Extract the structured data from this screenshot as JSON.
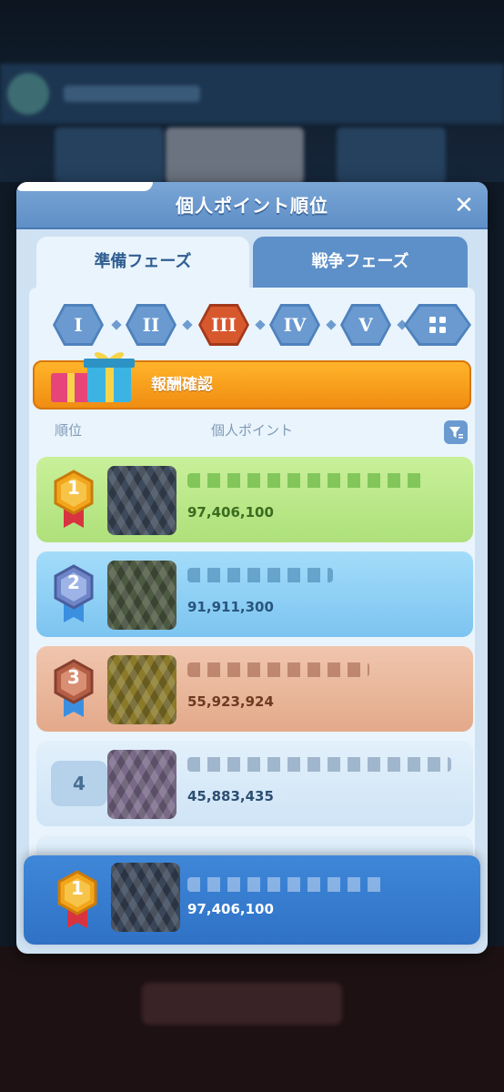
{
  "modal": {
    "title": "個人ポイント順位",
    "close_label": "✕",
    "tabs": [
      {
        "label": "準備フェーズ",
        "active": true
      },
      {
        "label": "戦争フェーズ",
        "active": false
      }
    ],
    "phases": [
      {
        "label": "I",
        "active": false
      },
      {
        "label": "II",
        "active": false
      },
      {
        "label": "III",
        "active": true
      },
      {
        "label": "IV",
        "active": false
      },
      {
        "label": "V",
        "active": false
      },
      {
        "label": "grid-icon",
        "active": false
      }
    ],
    "reward_label": "報酬確認",
    "columns": {
      "rank": "順位",
      "points": "個人ポイント"
    },
    "rows": [
      {
        "rank": "1",
        "points": "97,406,100",
        "color": "#bde98c",
        "text_color": "#3b6b1e",
        "medal": "gold"
      },
      {
        "rank": "2",
        "points": "91,911,300",
        "color": "#8fd0f5",
        "text_color": "#29557d",
        "medal": "silver"
      },
      {
        "rank": "3",
        "points": "55,923,924",
        "color": "#eab79c",
        "text_color": "#6e3a22",
        "medal": "bronze"
      },
      {
        "rank": "4",
        "points": "45,883,435",
        "color": "#d6e9f8",
        "text_color": "#2d4f72",
        "medal": "none"
      }
    ],
    "own_rank": {
      "rank": "1",
      "points": "97,406,100",
      "medal": "gold"
    }
  },
  "colors": {
    "gold": "#f2a51b",
    "silver": "#6e86c8",
    "bronze": "#b35e45",
    "accent_orange": "#f5a020",
    "active_phase": "#d8582e"
  }
}
